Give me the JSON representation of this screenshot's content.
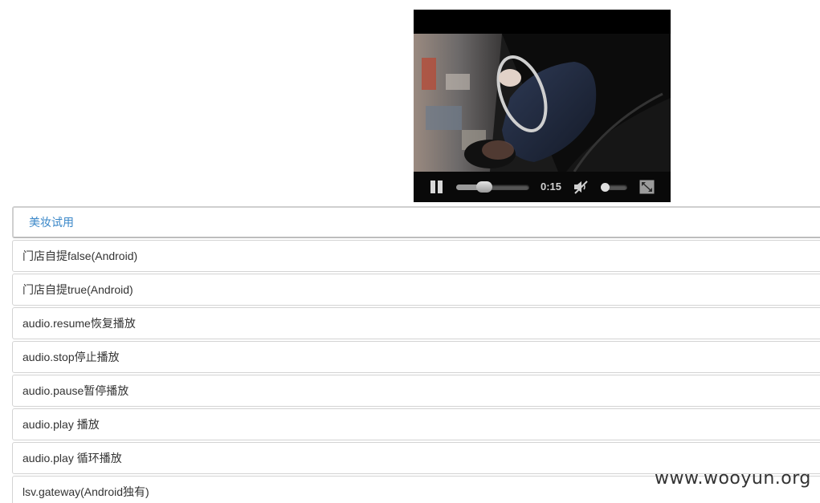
{
  "video": {
    "time": "0:15",
    "progress_fraction": 0.38,
    "volume_fraction": 0.1,
    "muted": true,
    "icons": {
      "play_state": "pause-icon",
      "mute": "speaker-muted-icon",
      "fullscreen": "fullscreen-icon"
    }
  },
  "list": {
    "header": "美妆试用",
    "items": [
      "门店自提false(Android)",
      "门店自提true(Android)",
      "audio.resume恢复播放",
      "audio.stop停止播放",
      "audio.pause暂停播放",
      "audio.play 播放",
      "audio.play 循环播放",
      "lsv.gateway(Android独有)"
    ]
  },
  "watermark": "www.wooyun.org",
  "colors": {
    "link_blue": "#3a87c8",
    "border": "#d3d3d3",
    "player_bar": "#0a0a0a"
  }
}
